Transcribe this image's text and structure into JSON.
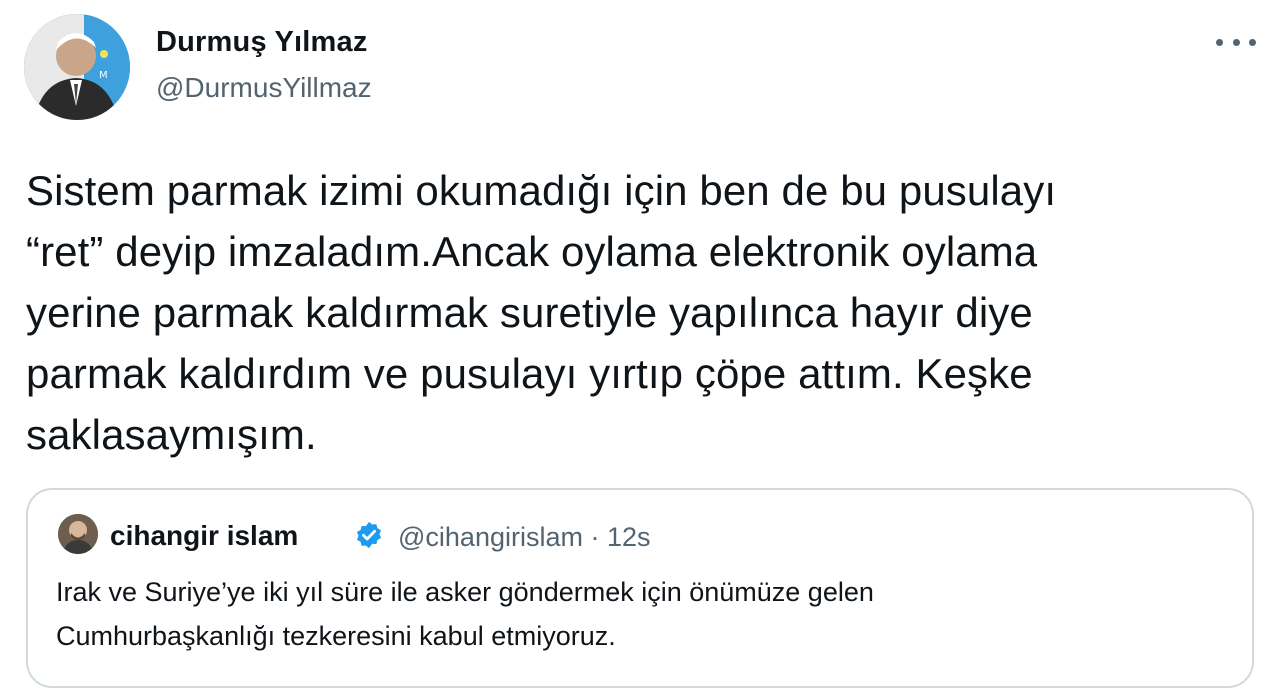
{
  "author": {
    "display_name": "Durmuş Yılmaz",
    "handle": "@DurmusYillmaz",
    "avatar_icon": "profile-photo"
  },
  "menu": {
    "icon": "more-horizontal-icon"
  },
  "tweet": {
    "text": "Sistem parmak izimi okumadığı için ben de bu pusulayı\n“ret” deyip imzaladım.Ancak oylama elektronik oylama\nyerine parmak kaldırmak suretiyle yapılınca hayır diye\nparmak kaldırdım ve pusulayı yırtıp çöpe attım. Keşke\nsaklasaymışım."
  },
  "quoted": {
    "display_name": "cihangir islam",
    "verified_icon": "verified-badge-icon",
    "handle_time": "@cihangirislam · 12s",
    "text": "Irak ve Suriye’ye iki yıl süre ile asker göndermek için önümüze gelen\nCumhurbaşkanlığı tezkeresini kabul etmiyoruz."
  },
  "colors": {
    "text_primary": "#0f1419",
    "text_secondary": "#536471",
    "border": "#cfd9de",
    "verified": "#1d9bf0"
  }
}
